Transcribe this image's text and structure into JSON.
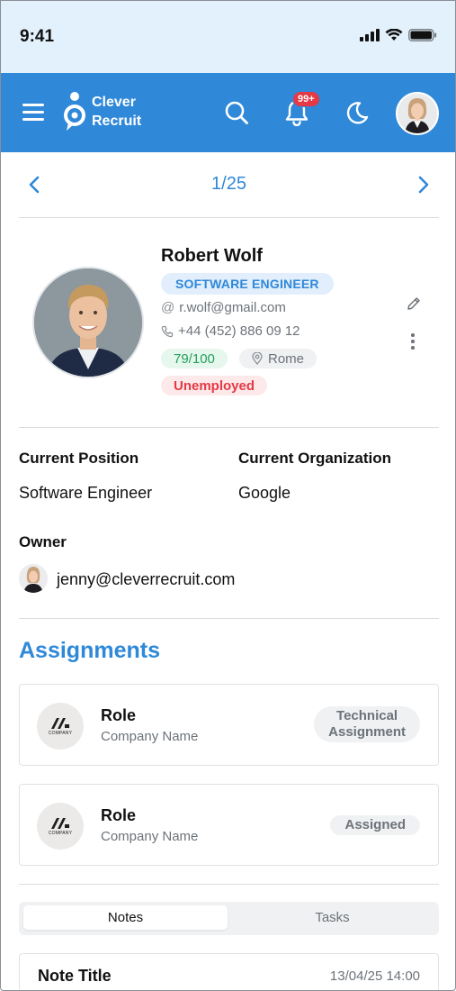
{
  "status_bar": {
    "time": "9:41"
  },
  "header": {
    "brand_line1": "Clever",
    "brand_line2": "Recruit",
    "notification_badge": "99+",
    "accent_color": "#2f88d8"
  },
  "pager": {
    "position": "1/25"
  },
  "candidate": {
    "name": "Robert Wolf",
    "title": "SOFTWARE ENGINEER",
    "email": "r.wolf@gmail.com",
    "phone": "+44 (452) 886 09 12",
    "score": "79/100",
    "location": "Rome",
    "employment_status": "Unemployed"
  },
  "details": {
    "current_position_label": "Current Position",
    "current_position_value": "Software Engineer",
    "current_org_label": "Current Organization",
    "current_org_value": "Google",
    "owner_label": "Owner",
    "owner_email": "jenny@cleverrecruit.com"
  },
  "assignments": {
    "title": "Assignments",
    "items": [
      {
        "role": "Role",
        "company": "Company Name",
        "tag_line1": "Technical",
        "tag_line2": "Assignment",
        "logo_text": "COMPANY"
      },
      {
        "role": "Role",
        "company": "Company Name",
        "tag_line1": "Assigned",
        "tag_line2": "",
        "logo_text": "COMPANY"
      }
    ]
  },
  "tabs": {
    "notes": "Notes",
    "tasks": "Tasks",
    "selected": "Notes"
  },
  "note": {
    "title": "Note Title",
    "date": "13/04/25 14:00"
  }
}
